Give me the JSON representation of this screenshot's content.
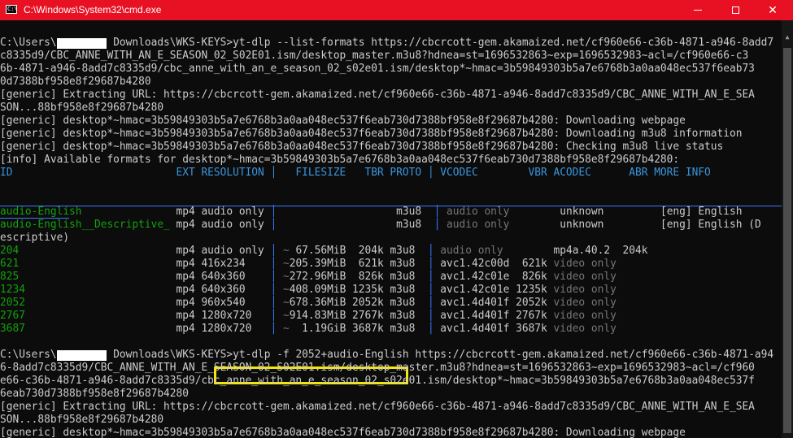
{
  "window": {
    "title": "C:\\Windows\\System32\\cmd.exe",
    "icon_text": "C:\\",
    "icon_name": "cmd-icon",
    "close_glyph": "✕"
  },
  "console": {
    "lines": [
      [
        [
          "w",
          "C:\\Users\\"
        ],
        [
          "w",
          "        "
        ],
        [
          "w",
          " Downloads\\WKS-KEYS>yt-dlp --list-formats https://cbcrcott-gem.akamaized.net/cf960e66-c36b-4871-a946-8add7"
        ]
      ],
      [
        [
          "w",
          "c8335d9/CBC_ANNE_WITH_AN_E_SEASON_02_S02E01.ism/desktop_master.m3u8?hdnea=st=1696532863~exp=1696532983~acl=/cf960e66-c3"
        ]
      ],
      [
        [
          "w",
          "6b-4871-a946-8add7c8335d9/cbc_anne_with_an_e_season_02_s02e01.ism/desktop*~hmac=3b59849303b5a7e6768b3a0aa048ec537f6eab73"
        ]
      ],
      [
        [
          "w",
          "0d7388bf958e8f29687b4280"
        ]
      ],
      [
        [
          "w",
          "[generic] Extracting URL: https://cbcrcott-gem.akamaized.net/cf960e66-c36b-4871-a946-8add7c8335d9/CBC_ANNE_WITH_AN_E_SEA"
        ]
      ],
      [
        [
          "w",
          "SON...88bf958e8f29687b4280"
        ]
      ],
      [
        [
          "w",
          "[generic] desktop*~hmac=3b59849303b5a7e6768b3a0aa048ec537f6eab730d7388bf958e8f29687b4280: Downloading webpage"
        ]
      ],
      [
        [
          "w",
          "[generic] desktop*~hmac=3b59849303b5a7e6768b3a0aa048ec537f6eab730d7388bf958e8f29687b4280: Downloading m3u8 information"
        ]
      ],
      [
        [
          "w",
          "[generic] desktop*~hmac=3b59849303b5a7e6768b3a0aa048ec537f6eab730d7388bf958e8f29687b4280: Checking m3u8 live status"
        ]
      ],
      [
        [
          "w",
          "[info] Available formats for desktop*~hmac=3b59849303b5a7e6768b3a0aa048ec537f6eab730d7388bf958e8f29687b4280:"
        ]
      ],
      [
        [
          "h",
          "ID                          EXT RESOLUTION │   FILESIZE   TBR PROTO │ VCODEC        VBR ACODEC      ABR MORE INFO"
        ]
      ],
      [
        [
          "w",
          ""
        ]
      ],
      [
        [
          "w",
          ""
        ]
      ],
      [
        [
          "g",
          "audio-English"
        ],
        [
          "w",
          "               mp4 audio only "
        ],
        [
          "b",
          "│"
        ],
        [
          "w",
          "                   m3u8  "
        ],
        [
          "b",
          "│"
        ],
        [
          "dg",
          " audio only"
        ],
        [
          "w",
          "        unknown         [eng] English"
        ]
      ],
      [
        [
          "g",
          "audio-English__Descriptive_"
        ],
        [
          "w",
          " mp4 audio only "
        ],
        [
          "b",
          "│"
        ],
        [
          "w",
          "                   m3u8  "
        ],
        [
          "b",
          "│"
        ],
        [
          "dg",
          " audio only"
        ],
        [
          "w",
          "        unknown         [eng] English (D"
        ]
      ],
      [
        [
          "w",
          "escriptive)"
        ]
      ],
      [
        [
          "g",
          "204"
        ],
        [
          "w",
          "                         mp4 audio only "
        ],
        [
          "b",
          "│"
        ],
        [
          "dg",
          " ~"
        ],
        [
          "w",
          " 67.56MiB  204k m3u8  "
        ],
        [
          "b",
          "│"
        ],
        [
          "dg",
          " audio only"
        ],
        [
          "w",
          "        mp4a.40.2  204k"
        ]
      ],
      [
        [
          "g",
          "621"
        ],
        [
          "w",
          "                         mp4 416x234    "
        ],
        [
          "b",
          "│"
        ],
        [
          "dg",
          " ~"
        ],
        [
          "w",
          "205.39MiB  621k m3u8  "
        ],
        [
          "b",
          "│"
        ],
        [
          "w",
          " avc1.42c00d  621k "
        ],
        [
          "dg",
          "video only"
        ]
      ],
      [
        [
          "g",
          "825"
        ],
        [
          "w",
          "                         mp4 640x360    "
        ],
        [
          "b",
          "│"
        ],
        [
          "dg",
          " ~"
        ],
        [
          "w",
          "272.96MiB  826k m3u8  "
        ],
        [
          "b",
          "│"
        ],
        [
          "w",
          " avc1.42c01e  826k "
        ],
        [
          "dg",
          "video only"
        ]
      ],
      [
        [
          "g",
          "1234"
        ],
        [
          "w",
          "                        mp4 640x360    "
        ],
        [
          "b",
          "│"
        ],
        [
          "dg",
          " ~"
        ],
        [
          "w",
          "408.09MiB 1235k m3u8  "
        ],
        [
          "b",
          "│"
        ],
        [
          "w",
          " avc1.42c01e 1235k "
        ],
        [
          "dg",
          "video only"
        ]
      ],
      [
        [
          "g",
          "2052"
        ],
        [
          "w",
          "                        mp4 960x540    "
        ],
        [
          "b",
          "│"
        ],
        [
          "dg",
          " ~"
        ],
        [
          "w",
          "678.36MiB 2052k m3u8  "
        ],
        [
          "b",
          "│"
        ],
        [
          "w",
          " avc1.4d401f 2052k "
        ],
        [
          "dg",
          "video only"
        ]
      ],
      [
        [
          "g",
          "2767"
        ],
        [
          "w",
          "                        mp4 1280x720   "
        ],
        [
          "b",
          "│"
        ],
        [
          "dg",
          " ~"
        ],
        [
          "w",
          "914.83MiB 2767k m3u8  "
        ],
        [
          "b",
          "│"
        ],
        [
          "w",
          " avc1.4d401f 2767k "
        ],
        [
          "dg",
          "video only"
        ]
      ],
      [
        [
          "g",
          "3687"
        ],
        [
          "w",
          "                        mp4 1280x720   "
        ],
        [
          "b",
          "│"
        ],
        [
          "dg",
          " ~"
        ],
        [
          "w",
          "  1.19GiB 3687k m3u8  "
        ],
        [
          "b",
          "│"
        ],
        [
          "w",
          " avc1.4d401f 3687k "
        ],
        [
          "dg",
          "video only"
        ]
      ],
      [
        [
          "w",
          ""
        ]
      ],
      [
        [
          "w",
          "C:\\Users\\"
        ],
        [
          "w",
          "        "
        ],
        [
          "w",
          " Downloads\\WKS-KEYS>yt-dlp -f 2052+audio-English https://cbcrcott-gem.akamaized.net/cf960e66-c36b-4871-a94"
        ]
      ],
      [
        [
          "w",
          "6-8add7c8335d9/CBC_ANNE_WITH_AN_E_SEASON_02_S02E01.ism/desktop_master.m3u8?hdnea=st=1696532863~exp=1696532983~acl=/cf960"
        ]
      ],
      [
        [
          "w",
          "e66-c36b-4871-a946-8add7c8335d9/cbc_anne_with_an_e_season_02_s02e01.ism/desktop*~hmac=3b59849303b5a7e6768b3a0aa048ec537f"
        ]
      ],
      [
        [
          "w",
          "6eab730d7388bf958e8f29687b4280"
        ]
      ],
      [
        [
          "w",
          "[generic] Extracting URL: https://cbcrcott-gem.akamaized.net/cf960e66-c36b-4871-a946-8add7c8335d9/CBC_ANNE_WITH_AN_E_SEA"
        ]
      ],
      [
        [
          "w",
          "SON...88bf958e8f29687b4280"
        ]
      ],
      [
        [
          "w",
          "[generic] desktop*~hmac=3b59849303b5a7e6768b3a0aa048ec537f6eab730d7388bf958e8f29687b4280: Downloading webpage"
        ]
      ]
    ]
  },
  "colors": {
    "titlebar": "#e81123",
    "background": "#0c0c0c",
    "text": "#cccccc",
    "format_id": "#13a10e",
    "dim": "#767676",
    "separator": "#3b78ff",
    "highlight": "#f5e800"
  }
}
